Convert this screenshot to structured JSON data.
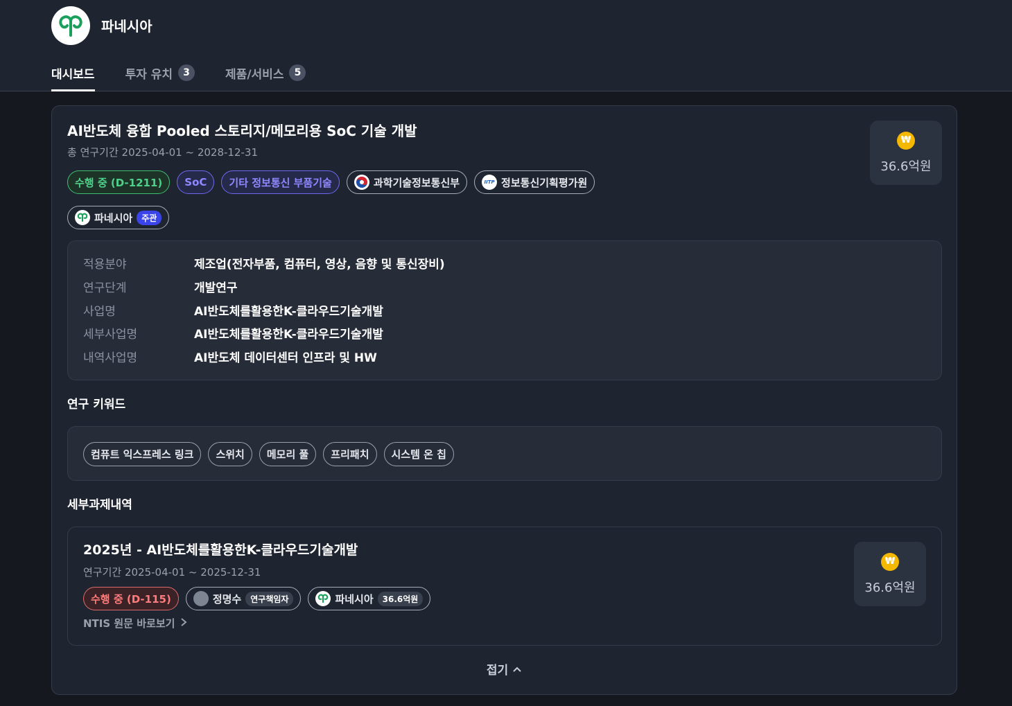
{
  "header": {
    "company_name": "파네시아",
    "tabs": [
      {
        "label": "대시보드",
        "count": null
      },
      {
        "label": "투자 유치",
        "count": "3"
      },
      {
        "label": "제품/서비스",
        "count": "5"
      }
    ]
  },
  "project": {
    "title": "AI반도체 융합 Pooled 스토리지/메모리용 SoC 기술 개발",
    "period": "총 연구기간 2025-04-01 ~ 2028-12-31",
    "amount": "36.6억원",
    "status_chip": "수행 중 (D-1211)",
    "tag_chips": [
      "SoC",
      "기타 정보통신 부품기술"
    ],
    "org_chips": [
      {
        "label": "과학기술정보통신부",
        "icon": "korea-emblem-icon"
      },
      {
        "label": "정보통신기획평가원",
        "icon": "iitp-logo-icon",
        "icon_text": "IITP"
      }
    ],
    "lead_org": {
      "label": "파네시아",
      "badge": "주관"
    },
    "info": [
      {
        "label": "적용분야",
        "value": "제조업(전자부품, 컴퓨터, 영상, 음향 및 통신장비)"
      },
      {
        "label": "연구단계",
        "value": "개발연구"
      },
      {
        "label": "사업명",
        "value": "AI반도체를활용한K-클라우드기술개발"
      },
      {
        "label": "세부사업명",
        "value": "AI반도체를활용한K-클라우드기술개발"
      },
      {
        "label": "내역사업명",
        "value": "AI반도체 데이터센터 인프라 및 HW"
      }
    ]
  },
  "keywords": {
    "heading": "연구 키워드",
    "items": [
      "컴퓨트 익스프레스 링크",
      "스위치",
      "메모리 풀",
      "프리패치",
      "시스템 온 칩"
    ]
  },
  "subtasks": {
    "heading": "세부과제내역",
    "items": [
      {
        "title": "2025년 - AI반도체를활용한K-클라우드기술개발",
        "period": "연구기간 2025-04-01 ~ 2025-12-31",
        "status_chip": "수행 중 (D-115)",
        "person": {
          "name": "정명수",
          "role": "연구책임자"
        },
        "org": {
          "name": "파네시아",
          "amount": "36.6억원"
        },
        "amount": "36.6억원",
        "link_label": "NTIS 원문 바로보기"
      }
    ]
  },
  "collapse_label": "접기",
  "won_symbol": "₩",
  "colors": {
    "accent_green": "#4fd08a",
    "accent_purple": "#8e88ff",
    "accent_red": "#ff7b7b",
    "won_yellow": "#f5b800",
    "badge_blue": "#3a44e8"
  }
}
